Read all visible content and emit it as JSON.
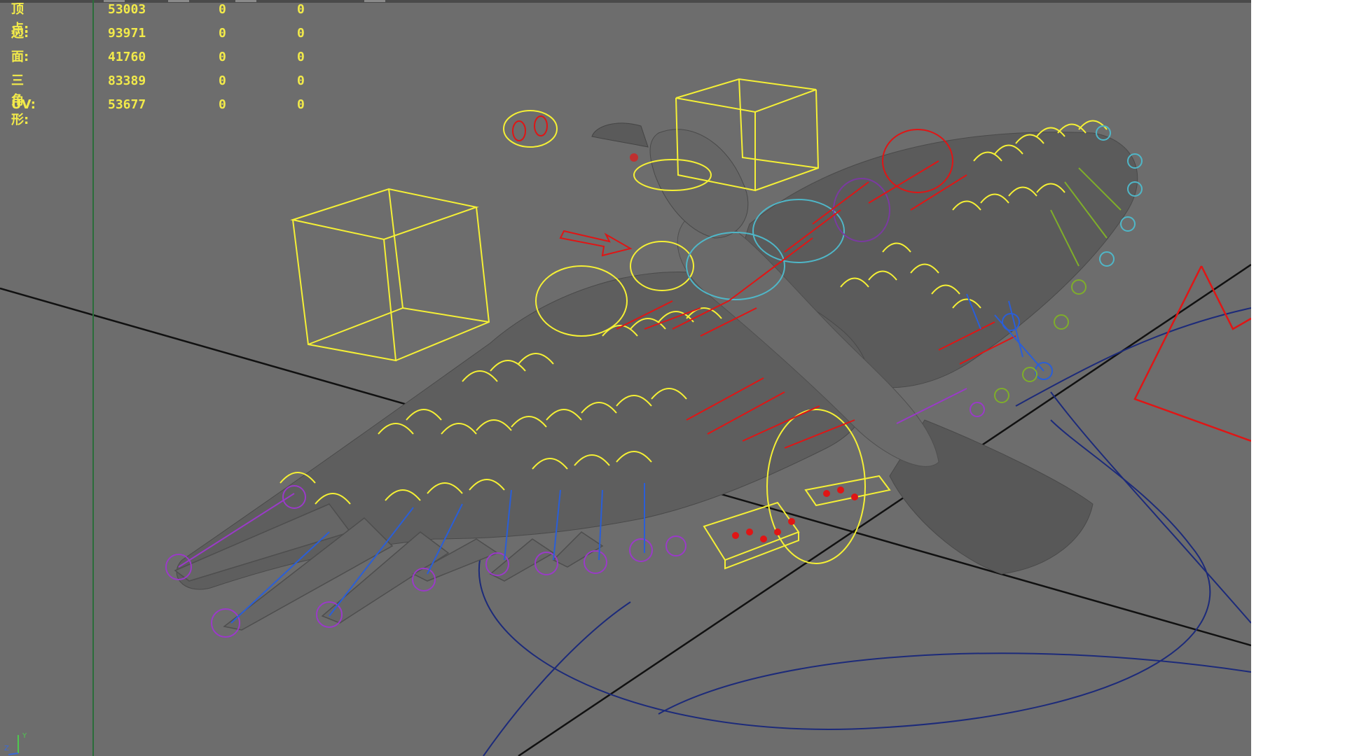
{
  "hud": {
    "rows": [
      {
        "label": "顶点:",
        "value": "53003",
        "col2": "0",
        "col3": "0"
      },
      {
        "label": "边:",
        "value": "93971",
        "col2": "0",
        "col3": "0"
      },
      {
        "label": "面:",
        "value": "41760",
        "col2": "0",
        "col3": "0"
      },
      {
        "label": "三角形:",
        "value": "83389",
        "col2": "0",
        "col3": "0"
      },
      {
        "label": "UV:",
        "value": "53677",
        "col2": "0",
        "col3": "0"
      }
    ]
  },
  "axis_gizmo": {
    "y_label": "Y",
    "z_label": "Z"
  },
  "colors": {
    "viewport_bg": "#6d6d6d",
    "hud_text": "#f2ea4a",
    "control_yellow": "#f5f035",
    "control_red": "#e01515",
    "control_blue": "#2a5ed8",
    "control_purple": "#9a3ac8",
    "control_cyan": "#4fb7c8",
    "control_green": "#7fae2a",
    "motion_path": "#1c2a7a",
    "grid_line": "#111111",
    "axis_line": "#2a6d3a"
  },
  "scene": {
    "object": "eagle-rig",
    "description_icons": [
      "bird-mesh-icon",
      "control-cube-icon",
      "ik-handle-icon"
    ]
  }
}
